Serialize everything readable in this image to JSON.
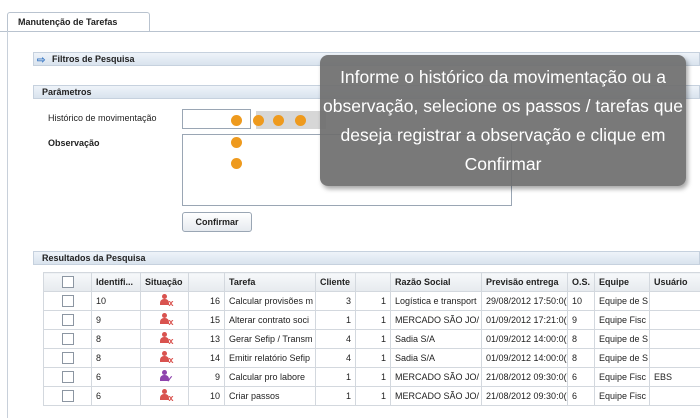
{
  "tab": {
    "label": "Manutenção de Tarefas"
  },
  "filters": {
    "title": "Filtros de Pesquisa"
  },
  "params": {
    "title": "Parâmetros",
    "historico_label": "Histórico de movimentação",
    "historico_value": "",
    "observacao_label": "Observação",
    "observacao_value": "",
    "confirm_label": "Confirmar"
  },
  "results": {
    "title": "Resultados da Pesquisa",
    "columns": [
      "",
      "Identifi...",
      "Situação",
      "",
      "Tarefa",
      "Cliente",
      "",
      "Razão Social",
      "Previsão entrega",
      "O.S.",
      "Equipe",
      "Usuário"
    ],
    "rows": [
      {
        "id": "10",
        "status": "error",
        "num": "16",
        "tarefa": "Calcular provisões m",
        "cliente": "3",
        "cli2": "1",
        "razao": "Logística e transport",
        "previsao": "29/08/2012 17:50:0(",
        "os": "10",
        "equipe": "Equipe de S",
        "usuario": ""
      },
      {
        "id": "9",
        "status": "error",
        "num": "15",
        "tarefa": "Alterar contrato soci",
        "cliente": "1",
        "cli2": "1",
        "razao": "MERCADO SÃO JO/",
        "previsao": "01/09/2012 17:21:0(",
        "os": "9",
        "equipe": "Equipe Fisc",
        "usuario": ""
      },
      {
        "id": "8",
        "status": "error",
        "num": "13",
        "tarefa": "Gerar Sefip / Transm",
        "cliente": "4",
        "cli2": "1",
        "razao": "Sadia S/A",
        "previsao": "01/09/2012 14:00:0(",
        "os": "8",
        "equipe": "Equipe de S",
        "usuario": ""
      },
      {
        "id": "8",
        "status": "error",
        "num": "14",
        "tarefa": "Emitir relatório Sefip",
        "cliente": "4",
        "cli2": "1",
        "razao": "Sadia S/A",
        "previsao": "01/09/2012 14:00:0(",
        "os": "8",
        "equipe": "Equipe de S",
        "usuario": ""
      },
      {
        "id": "6",
        "status": "ok",
        "num": "9",
        "tarefa": "Calcular pro labore",
        "cliente": "1",
        "cli2": "1",
        "razao": "MERCADO SÃO JO/",
        "previsao": "21/08/2012 09:30:0(",
        "os": "6",
        "equipe": "Equipe Fisc",
        "usuario": "EBS"
      },
      {
        "id": "6",
        "status": "error",
        "num": "10",
        "tarefa": "Criar passos",
        "cliente": "1",
        "cli2": "1",
        "razao": "MERCADO SÃO JO/",
        "previsao": "21/08/2012 09:30:0(",
        "os": "6",
        "equipe": "Equipe Fisc",
        "usuario": ""
      }
    ]
  },
  "tooltip": {
    "text": "Informe o histórico da movimentação ou a observação, selecione os passos / tarefas que deseja registrar a observação e clique em Confirmar"
  },
  "colors": {
    "dot": "#ee9a1e",
    "status_error": "#d9534f",
    "status_ok": "#8e44ad"
  }
}
